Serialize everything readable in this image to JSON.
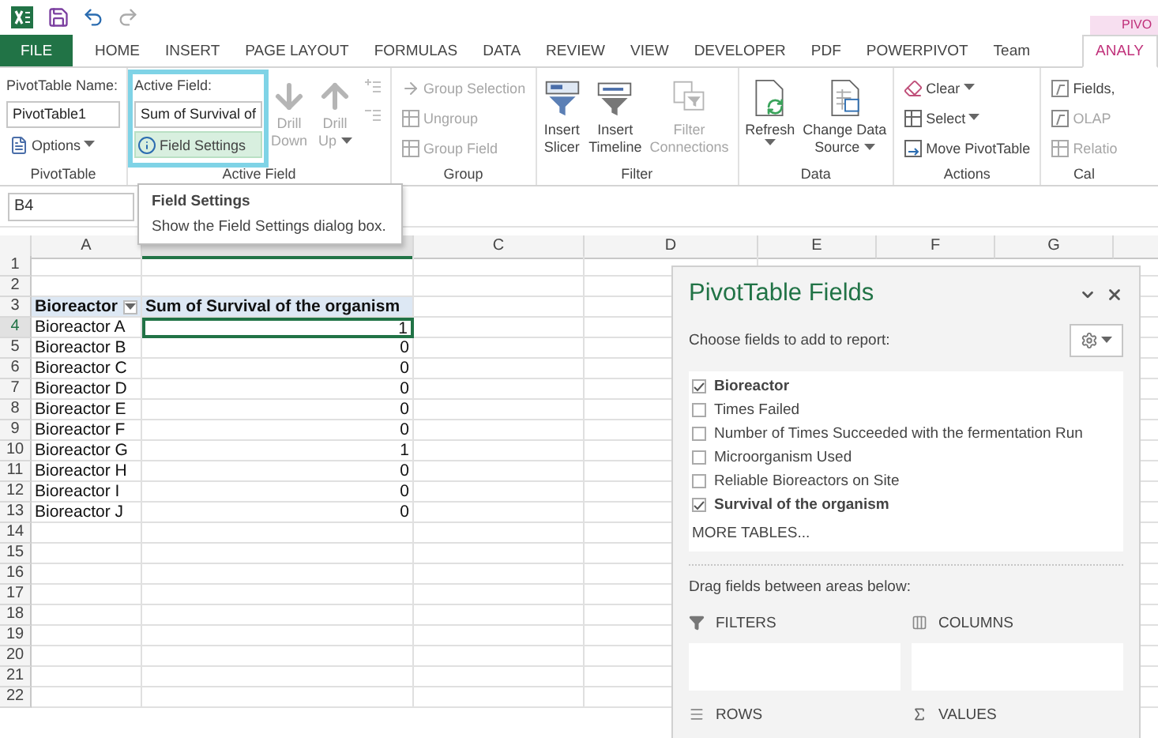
{
  "context_tab": "PIVO",
  "tabs": [
    {
      "label": "FILE",
      "kind": "file",
      "selected": false
    },
    {
      "label": "HOME",
      "kind": "tab",
      "selected": false
    },
    {
      "label": "INSERT",
      "kind": "tab",
      "selected": false
    },
    {
      "label": "PAGE LAYOUT",
      "kind": "tab",
      "selected": false
    },
    {
      "label": "FORMULAS",
      "kind": "tab",
      "selected": false
    },
    {
      "label": "DATA",
      "kind": "tab",
      "selected": false
    },
    {
      "label": "REVIEW",
      "kind": "tab",
      "selected": false
    },
    {
      "label": "VIEW",
      "kind": "tab",
      "selected": false
    },
    {
      "label": "DEVELOPER",
      "kind": "tab",
      "selected": false
    },
    {
      "label": "PDF",
      "kind": "tab",
      "selected": false
    },
    {
      "label": "POWERPIVOT",
      "kind": "tab",
      "selected": false
    },
    {
      "label": "Team",
      "kind": "tab",
      "selected": false
    },
    {
      "label": "ANALY",
      "kind": "context",
      "selected": true
    }
  ],
  "ribbon_groups": [
    {
      "label": "PivotTable",
      "columns": [
        {
          "highlighted": false,
          "items": [
            {
              "kind": "label",
              "label": "PivotTable Name:"
            },
            {
              "kind": "field",
              "value": "PivotTable1"
            },
            {
              "kind": "small",
              "label": "Options",
              "dropdown": true,
              "disabled": false,
              "hovered": false
            }
          ]
        }
      ]
    },
    {
      "label": "Active Field",
      "columns": [
        {
          "highlighted": true,
          "items": [
            {
              "kind": "label",
              "label": "Active Field:"
            },
            {
              "kind": "field",
              "value": "Sum of Survival of"
            },
            {
              "kind": "small",
              "label": "Field Settings",
              "dropdown": false,
              "disabled": false,
              "hovered": true
            }
          ]
        },
        {
          "highlighted": false,
          "items": [
            {
              "kind": "large",
              "lines": [
                "Drill",
                "Down"
              ],
              "dropdown": false,
              "disabled": true
            }
          ]
        },
        {
          "highlighted": false,
          "items": [
            {
              "kind": "large",
              "lines": [
                "Drill",
                "Up"
              ],
              "dropdown": true,
              "disabled": true
            }
          ]
        },
        {
          "highlighted": false,
          "items": [
            {
              "kind": "icon",
              "disabled": true
            },
            {
              "kind": "icon",
              "disabled": true
            }
          ]
        }
      ]
    },
    {
      "label": "Group",
      "columns": [
        {
          "highlighted": false,
          "items": [
            {
              "kind": "small",
              "label": "Group Selection",
              "dropdown": false,
              "disabled": true,
              "hovered": false
            },
            {
              "kind": "small",
              "label": "Ungroup",
              "dropdown": false,
              "disabled": true,
              "hovered": false
            },
            {
              "kind": "small",
              "label": "Group Field",
              "dropdown": false,
              "disabled": true,
              "hovered": false
            }
          ]
        }
      ]
    },
    {
      "label": "Filter",
      "columns": [
        {
          "highlighted": false,
          "items": [
            {
              "kind": "large",
              "lines": [
                "Insert",
                "Slicer"
              ],
              "dropdown": false,
              "disabled": false
            }
          ]
        },
        {
          "highlighted": false,
          "items": [
            {
              "kind": "large",
              "lines": [
                "Insert",
                "Timeline"
              ],
              "dropdown": false,
              "disabled": false
            }
          ]
        },
        {
          "highlighted": false,
          "items": [
            {
              "kind": "large",
              "lines": [
                "Filter",
                "Connections"
              ],
              "dropdown": false,
              "disabled": true
            }
          ]
        }
      ]
    },
    {
      "label": "Data",
      "columns": [
        {
          "highlighted": false,
          "items": [
            {
              "kind": "large",
              "lines": [
                "Refresh"
              ],
              "dropdown": true,
              "disabled": false
            }
          ]
        },
        {
          "highlighted": false,
          "items": [
            {
              "kind": "large",
              "lines": [
                "Change Data",
                "Source"
              ],
              "dropdown": true,
              "disabled": false
            }
          ]
        }
      ]
    },
    {
      "label": "Actions",
      "columns": [
        {
          "highlighted": false,
          "items": [
            {
              "kind": "small",
              "label": "Clear",
              "dropdown": true,
              "disabled": false,
              "hovered": false
            },
            {
              "kind": "small",
              "label": "Select",
              "dropdown": true,
              "disabled": false,
              "hovered": false
            },
            {
              "kind": "small",
              "label": "Move PivotTable",
              "dropdown": false,
              "disabled": false,
              "hovered": false
            }
          ]
        }
      ]
    },
    {
      "label": "Cal",
      "columns": [
        {
          "highlighted": false,
          "items": [
            {
              "kind": "small",
              "label": "Fields,",
              "dropdown": false,
              "disabled": false,
              "hovered": false
            },
            {
              "kind": "small",
              "label": "OLAP",
              "dropdown": false,
              "disabled": true,
              "hovered": false
            },
            {
              "kind": "small",
              "label": "Relatio",
              "dropdown": false,
              "disabled": true,
              "hovered": false
            }
          ]
        }
      ]
    }
  ],
  "name_box": "B4",
  "tooltip": {
    "title": "Field Settings",
    "text": "Show the Field Settings dialog box."
  },
  "columns": [
    {
      "label": "A",
      "selected": false
    },
    {
      "selected": true
    },
    {
      "label": "C",
      "selected": false
    },
    {
      "label": "D",
      "selected": false
    },
    {
      "label": "E",
      "selected": false
    },
    {
      "label": "F",
      "selected": false
    },
    {
      "label": "G",
      "selected": false
    }
  ],
  "rows": [
    {
      "label": "1",
      "kind": "empty",
      "selected": false
    },
    {
      "label": "2",
      "kind": "empty",
      "selected": false
    },
    {
      "label": "3",
      "kind": "header",
      "selected": false,
      "cells": [
        "Bioreactor",
        "Sum of Survival of the organism"
      ]
    },
    {
      "label": "4",
      "kind": "data",
      "selected": true,
      "cells": [
        "Bioreactor A",
        "1"
      ]
    },
    {
      "label": "5",
      "kind": "data",
      "selected": false,
      "cells": [
        "Bioreactor B",
        "0"
      ]
    },
    {
      "label": "6",
      "kind": "data",
      "selected": false,
      "cells": [
        "Bioreactor C",
        "0"
      ]
    },
    {
      "label": "7",
      "kind": "data",
      "selected": false,
      "cells": [
        "Bioreactor D",
        "0"
      ]
    },
    {
      "label": "8",
      "kind": "data",
      "selected": false,
      "cells": [
        "Bioreactor E",
        "0"
      ]
    },
    {
      "label": "9",
      "kind": "data",
      "selected": false,
      "cells": [
        "Bioreactor F",
        "0"
      ]
    },
    {
      "label": "10",
      "kind": "data",
      "selected": false,
      "cells": [
        "Bioreactor G",
        "1"
      ]
    },
    {
      "label": "11",
      "kind": "data",
      "selected": false,
      "cells": [
        "Bioreactor H",
        "0"
      ]
    },
    {
      "label": "12",
      "kind": "data",
      "selected": false,
      "cells": [
        "Bioreactor I",
        "0"
      ]
    },
    {
      "label": "13",
      "kind": "data",
      "selected": false,
      "cells": [
        "Bioreactor J",
        "0"
      ]
    },
    {
      "label": "14",
      "kind": "empty",
      "selected": false
    },
    {
      "label": "15",
      "kind": "empty",
      "selected": false
    },
    {
      "label": "16",
      "kind": "empty",
      "selected": false
    },
    {
      "label": "17",
      "kind": "empty",
      "selected": false
    },
    {
      "label": "18",
      "kind": "empty",
      "selected": false
    },
    {
      "label": "19",
      "kind": "empty",
      "selected": false
    },
    {
      "label": "20",
      "kind": "empty",
      "selected": false
    },
    {
      "label": "21",
      "kind": "empty",
      "selected": false
    },
    {
      "label": "22",
      "kind": "empty",
      "selected": false
    }
  ],
  "pane": {
    "title": "PivotTable Fields",
    "subtitle": "Choose fields to add to report:",
    "fields": [
      {
        "label": "Bioreactor",
        "checked": true
      },
      {
        "label": "Times Failed",
        "checked": false
      },
      {
        "label": "Number of Times Succeeded with the fermentation Run",
        "checked": false
      },
      {
        "label": "Microorganism Used",
        "checked": false
      },
      {
        "label": "Reliable Bioreactors on Site",
        "checked": false
      },
      {
        "label": "Survival of the organism",
        "checked": true
      }
    ],
    "more_tables": "MORE TABLES...",
    "drag_hint": "Drag fields between areas below:",
    "areas": [
      {
        "kind": "filters",
        "label": "FILTERS"
      },
      {
        "kind": "columns",
        "label": "COLUMNS"
      },
      {
        "kind": "rows",
        "label": "ROWS"
      },
      {
        "kind": "values",
        "label": "VALUES"
      }
    ]
  }
}
